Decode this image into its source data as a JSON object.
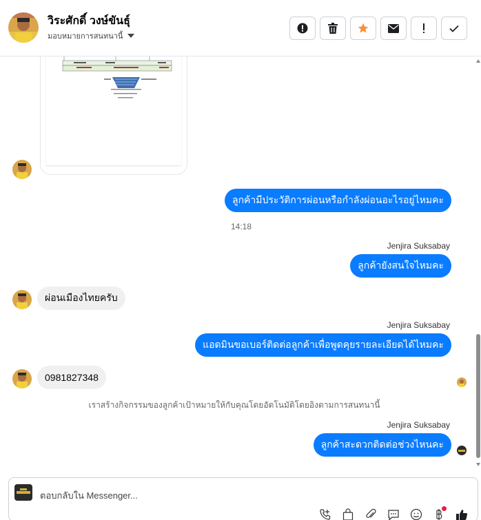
{
  "header": {
    "name": "วิระศักดิ์ วงษ์ขันธุ์",
    "assign_label": "มอบหมายการสนทนานี้",
    "buttons": [
      "alert-circle-icon",
      "trash-icon",
      "star-icon",
      "envelope-icon",
      "exclamation-icon",
      "check-icon"
    ]
  },
  "messages": {
    "out1": "ลูกค้ามีประวัติการผ่อนหรือกำลังผ่อนอะไรอยู่ไหมคะ",
    "time1": "14:18",
    "sender1": "Jenjira Suksabay",
    "out2": "ลูกค้ายังสนใจไหมคะ",
    "in1": "ผ่อนเมืองไทยครับ",
    "sender2": "Jenjira Suksabay",
    "out3": "แอดมินขอเบอร์ติดต่อลูกค้าเพื่อพูดคุยรายละเอียดได้ไหมคะ",
    "in2": "0981827348",
    "system": "เราสร้างกิจกรรมของลูกค้าเป้าหมายให้กับคุณโดยอัตโนมัติโดยอิงตามการสนทนานี้",
    "sender3": "Jenjira Suksabay",
    "out4": "ลูกค้าสะดวกติดต่อช่วงไหนคะ"
  },
  "composer": {
    "placeholder": "ตอบกลับใน Messenger..."
  },
  "colors": {
    "accent": "#0a7cff",
    "star": "#f7923a"
  }
}
